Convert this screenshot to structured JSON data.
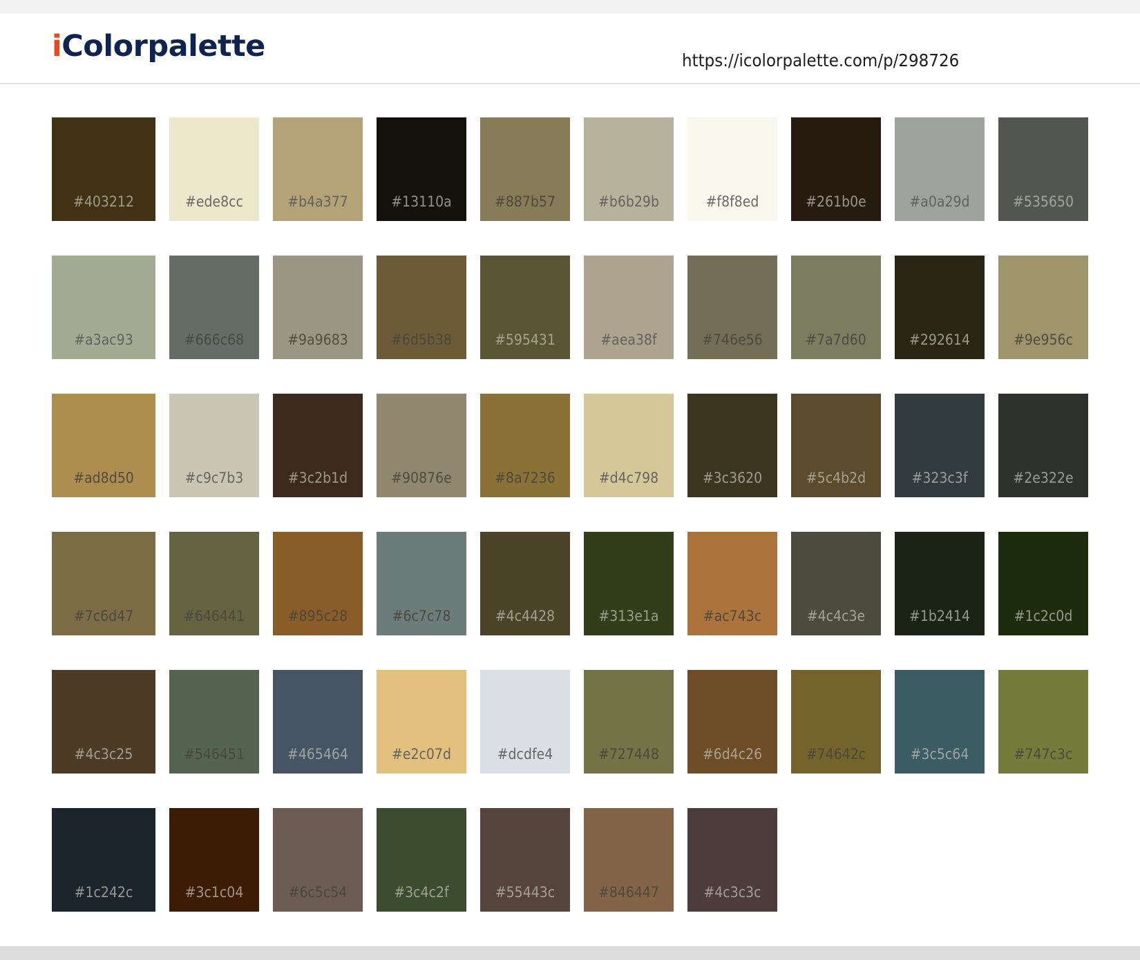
{
  "header": {
    "logo_accent": "i",
    "logo_rest": "Colorpalette",
    "url": "https://icolorpalette.com/p/298726"
  },
  "colors": [
    "#403212",
    "#ede8cc",
    "#b4a377",
    "#13110a",
    "#887b57",
    "#b6b29b",
    "#f8f8ed",
    "#261b0e",
    "#a0a29d",
    "#535650",
    "#a3ac93",
    "#666c68",
    "#9a9683",
    "#6d5b38",
    "#595431",
    "#aea38f",
    "#746e56",
    "#7a7d60",
    "#292614",
    "#9e956c",
    "#ad8d50",
    "#c9c7b3",
    "#3c2b1d",
    "#90876e",
    "#8a7236",
    "#d4c798",
    "#3c3620",
    "#5c4b2d",
    "#323c3f",
    "#2e322e",
    "#7c6d47",
    "#646441",
    "#895c28",
    "#6c7c78",
    "#4c4428",
    "#313e1a",
    "#ac743c",
    "#4c4c3e",
    "#1b2414",
    "#1c2c0d",
    "#4c3c25",
    "#546451",
    "#465464",
    "#e2c07d",
    "#dcdfe4",
    "#727448",
    "#6d4c26",
    "#74642c",
    "#3c5c64",
    "#747c3c",
    "#1c242c",
    "#3c1c04",
    "#6c5c54",
    "#3c4c2f",
    "#55443c",
    "#846447",
    "#4c3c3c"
  ]
}
